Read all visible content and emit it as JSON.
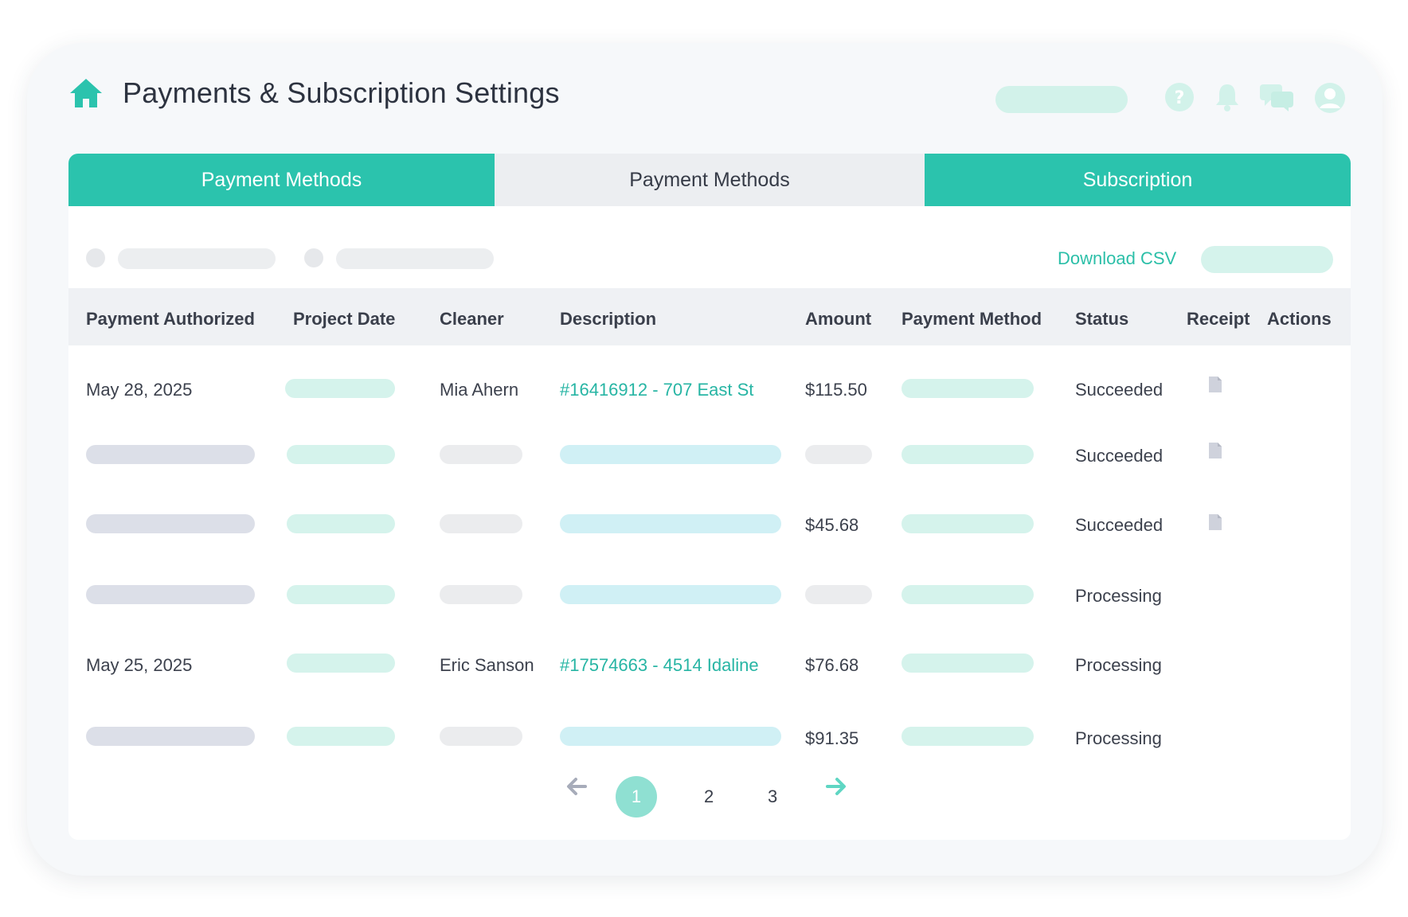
{
  "header": {
    "title": "Payments & Subscription Settings"
  },
  "tabs": [
    {
      "label": "Payment Methods",
      "active": true
    },
    {
      "label": "Payment Methods",
      "active": false
    },
    {
      "label": "Subscription",
      "active": true
    }
  ],
  "toolbar": {
    "download_csv": "Download CSV"
  },
  "table": {
    "columns": [
      "Payment Authorized",
      "Project Date",
      "Cleaner",
      "Description",
      "Amount",
      "Payment Method",
      "Status",
      "Receipt",
      "Actions"
    ],
    "rows": [
      {
        "payment_authorized": "May 28, 2025",
        "cleaner": "Mia Ahern",
        "description": "#16416912 - 707 East St",
        "amount": "$115.50",
        "status": "Succeeded",
        "receipt": true
      },
      {
        "payment_authorized": "",
        "cleaner": "",
        "description": "",
        "amount": "",
        "status": "Succeeded",
        "receipt": true
      },
      {
        "payment_authorized": "",
        "cleaner": "",
        "description": "",
        "amount": "$45.68",
        "status": "Succeeded",
        "receipt": true
      },
      {
        "payment_authorized": "",
        "cleaner": "",
        "description": "",
        "amount": "",
        "status": "Processing",
        "receipt": false
      },
      {
        "payment_authorized": "May 25, 2025",
        "cleaner": "Eric Sanson",
        "description": "#17574663 - 4514 Idaline",
        "amount": "$76.68",
        "status": "Processing",
        "receipt": false
      },
      {
        "payment_authorized": "",
        "cleaner": "",
        "description": "",
        "amount": "$91.35",
        "status": "Processing",
        "receipt": false
      }
    ]
  },
  "pagination": {
    "current": "1",
    "pages": [
      "1",
      "2",
      "3"
    ]
  },
  "colors": {
    "accent": "#2bc3ad",
    "link": "#27b5a4",
    "skeleton_mint": "#d5f3ec",
    "skeleton_blue": "#d0f0f5"
  },
  "icons": [
    "home-icon",
    "help-icon",
    "bell-icon",
    "chat-icon",
    "user-icon",
    "receipt-icon",
    "arrow-left-icon",
    "arrow-right-icon"
  ]
}
